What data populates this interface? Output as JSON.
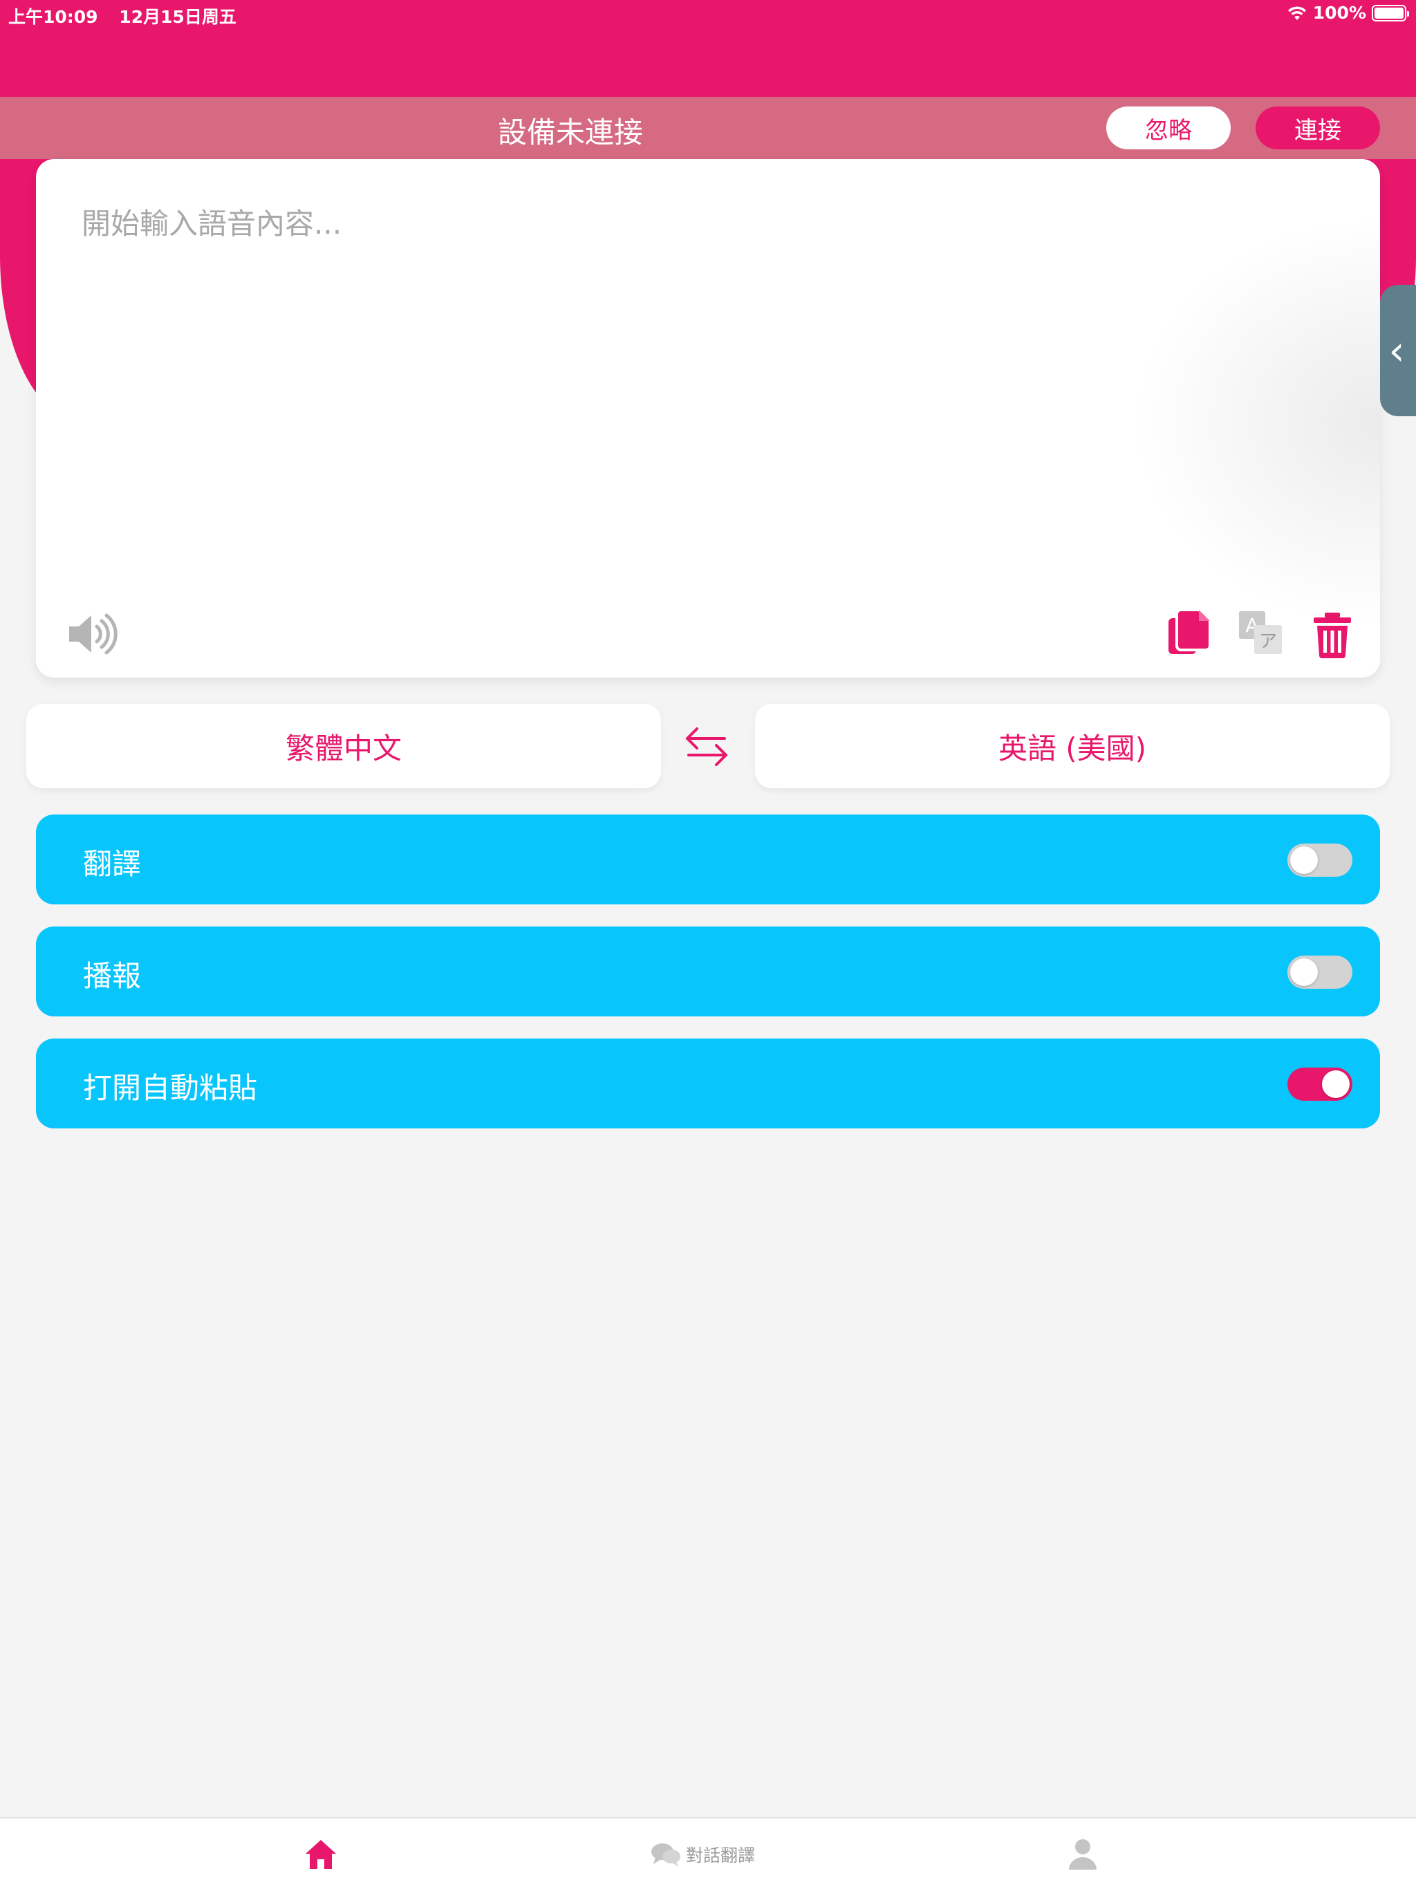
{
  "status_bar": {
    "time": "上午10:09",
    "date": "12月15日周五",
    "battery": "100%"
  },
  "banner": {
    "title": "設備未連接",
    "ignore_label": "忽略",
    "connect_label": "連接"
  },
  "text_input": {
    "placeholder": "開始輸入語音內容..."
  },
  "languages": {
    "source": "繁體中文",
    "target": "英語 (美國)"
  },
  "toggles": [
    {
      "label": "翻譯",
      "on": false
    },
    {
      "label": "播報",
      "on": false
    },
    {
      "label": "打開自動粘貼",
      "on": true
    }
  ],
  "tabs": {
    "home_icon": "home-icon",
    "chat_label": "對話翻譯",
    "profile_icon": "person-icon"
  },
  "colors": {
    "brand": "#e8176b",
    "banner": "#d56a82",
    "row": "#08c6fc",
    "background": "#f4f4f4"
  }
}
